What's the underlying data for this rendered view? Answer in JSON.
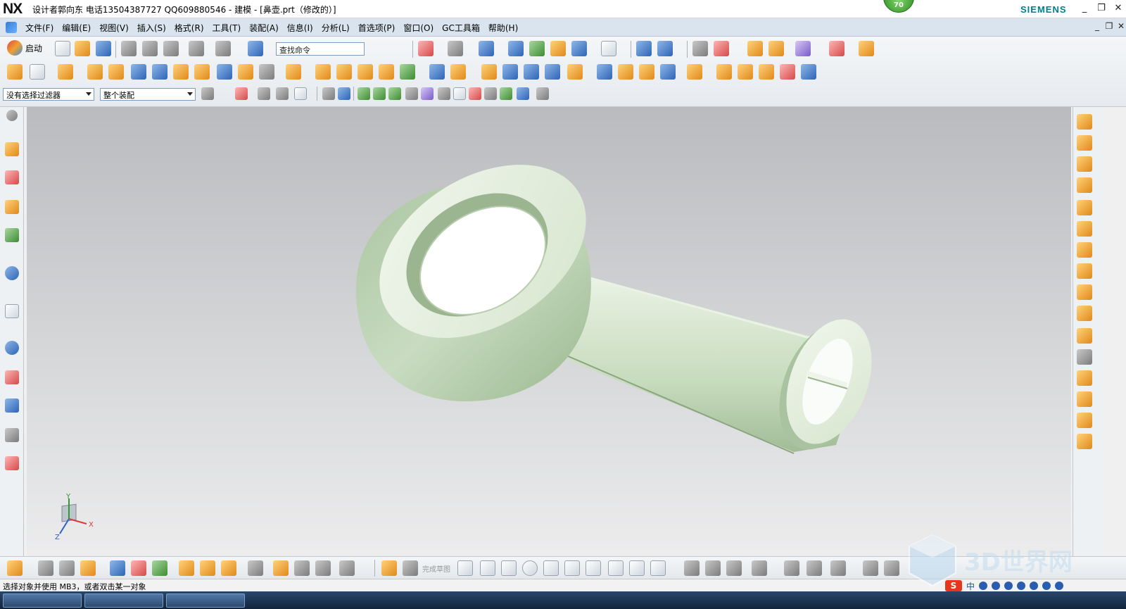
{
  "titlebar": {
    "logo": "NX",
    "title": "设计者郭向东  电话13504387727  QQ609880546 - 建模 - [鼻壶.prt（修改的）]",
    "badge": "70",
    "brand": "SIEMENS",
    "minimize": "_",
    "restore": "❐",
    "close": "✕"
  },
  "menubar": {
    "items": [
      "文件(F)",
      "编辑(E)",
      "视图(V)",
      "插入(S)",
      "格式(R)",
      "工具(T)",
      "装配(A)",
      "信息(I)",
      "分析(L)",
      "首选项(P)",
      "窗口(O)",
      "GC工具箱",
      "帮助(H)"
    ],
    "minimize": "_",
    "restore": "❐",
    "close": "✕"
  },
  "toolbar": {
    "start_label": "启动",
    "search_placeholder": "查找命令",
    "filter_value": "没有选择过滤器",
    "scope_value": "整个装配"
  },
  "bottom_toolbar": {
    "finish_sketch_label": "完成草图"
  },
  "status": {
    "message": "选择对象并使用 MB3，或者双击某一对象",
    "ime_brand": "S",
    "ime_lang": "中"
  },
  "triad": {
    "x_label": "X",
    "y_label": "Y",
    "z_label": "Z"
  },
  "watermark": {
    "text": "3D世界网"
  },
  "colors": {
    "model": "#c8dcc0",
    "menubar": "#d9e4ee",
    "viewport_top": "#b9bbbe",
    "viewport_bottom": "#ececed",
    "brand": "#00808a"
  }
}
